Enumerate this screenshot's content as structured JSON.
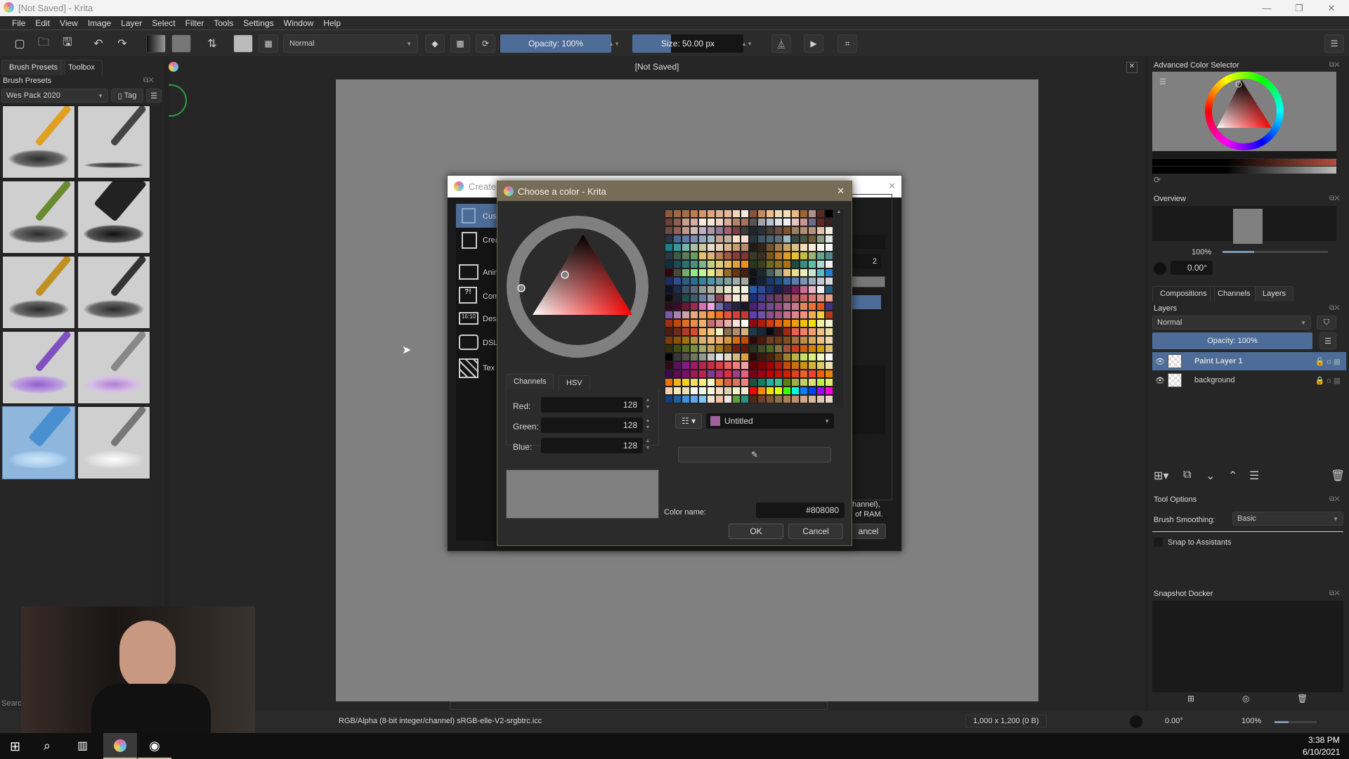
{
  "window": {
    "title": "[Not Saved]  - Krita",
    "minimize": "—",
    "maximize": "❐",
    "close": "✕"
  },
  "menu": [
    "File",
    "Edit",
    "View",
    "Image",
    "Layer",
    "Select",
    "Filter",
    "Tools",
    "Settings",
    "Window",
    "Help"
  ],
  "toolbar": {
    "blend_mode": "Normal",
    "opacity_label": "Opacity: 100%",
    "opacity_value": 1.0,
    "size_label": "Size: 50.00 px",
    "size_fill_fraction": 0.35,
    "icons": [
      "new-document",
      "open-document",
      "save",
      "undo",
      "redo",
      "gradient",
      "pattern",
      "swap-colors",
      "brush-preset",
      "workspace-chooser",
      "eraser",
      "preserve-alpha",
      "reload-preset",
      "mirror-horizontal",
      "mirror-vertical",
      "wrap-around"
    ]
  },
  "left_dock": {
    "tabs": [
      "Brush Presets",
      "Toolbox"
    ],
    "active_tab": 0,
    "title": "Brush Presets",
    "bundle": "Wes Pack 2020",
    "tag_label": "Tag",
    "search_placeholder": "Search",
    "brush_count": 10,
    "selected_brush": 8
  },
  "document": {
    "tab_title": "[Not Saved]",
    "canvas_color": "#808080"
  },
  "create_dialog": {
    "title": "Create new document",
    "title_visible": "Create n",
    "items": [
      "Custom Document",
      "Create from Clipboard",
      "Animation",
      "Comic Templates",
      "Design Templates",
      "DSLR Templates",
      "Texture Templates"
    ],
    "items_visible": [
      "Cus",
      "Crea",
      "Anin",
      "Com",
      "Des",
      "DSL",
      "Tex"
    ],
    "spin_value": "2",
    "info_text_1": "hannel),",
    "info_text_2": "of RAM.",
    "cancel_visible": "ancel",
    "close": "✕"
  },
  "color_dialog": {
    "title": "Choose a color - Krita",
    "close": "✕",
    "tabs": [
      "Channels",
      "HSV"
    ],
    "active_tab": 0,
    "channels": [
      {
        "label": "Red:",
        "value": "128"
      },
      {
        "label": "Green:",
        "value": "128"
      },
      {
        "label": "Blue:",
        "value": "128"
      }
    ],
    "preview_color": "#808080",
    "palette_name": "Untitled",
    "palette_swatch": "#a0609a",
    "color_name_label": "Color name:",
    "color_name_value": "#808080",
    "ok": "OK",
    "cancel": "Cancel",
    "palette_colors": [
      "#8d5a3c",
      "#a06a44",
      "#a86c48",
      "#c07c52",
      "#d8946a",
      "#dea47a",
      "#e0ae90",
      "#e4b898",
      "#f0d4c0",
      "#fae6dc",
      "#8a5238",
      "#c48a5c",
      "#ecbc8a",
      "#f0d8b8",
      "#f4dcb8",
      "#e8b880",
      "#9c6434",
      "#b0908a",
      "#5a2a20",
      "#000000",
      "#6a4030",
      "#886050",
      "#c4a090",
      "#d4aca4",
      "#f8eee0",
      "#f4e6d8",
      "#f0d4c0",
      "#d4b098",
      "#b48468",
      "#a87060",
      "#5a5454",
      "#a4a4ac",
      "#b8c0d0",
      "#dce0e8",
      "#f0f0f4",
      "#e4c4c4",
      "#c89494",
      "#6c6c8c",
      "#602828",
      "#3c2020",
      "#6a4a44",
      "#946058",
      "#c09890",
      "#d0bcb8",
      "#c0b0c0",
      "#a898a8",
      "#8e7898",
      "#a06070",
      "#784048",
      "#3c3c40",
      "#20262c",
      "#2c3038",
      "#484038",
      "#6c5040",
      "#7c5434",
      "#9c8064",
      "#b08c70",
      "#b49480",
      "#e4c4a8",
      "#f4ece0",
      "#283448",
      "#4a6894",
      "#5c7aa4",
      "#7c8cb0",
      "#94a8c0",
      "#a4b8c0",
      "#c4a490",
      "#c0b0a0",
      "#f4e0c8",
      "#f8dcd0",
      "#28343c",
      "#3c5868",
      "#4c6470",
      "#606c78",
      "#a0b8c4",
      "#384844",
      "#485440",
      "#6c5c3c",
      "#8c9c7c",
      "#e0e4e0",
      "#1e7c8c",
      "#3898a0",
      "#70b4b0",
      "#a8c0a4",
      "#d0c8a0",
      "#e8dcc8",
      "#e8d0b0",
      "#dcb48c",
      "#c89c6c",
      "#b88c6c",
      "#201c14",
      "#302418",
      "#74542c",
      "#a48048",
      "#c8a468",
      "#dcc08c",
      "#f4dcb0",
      "#f4ecd0",
      "#f8f8f0",
      "#f8f8f8",
      "#2c3448",
      "#3c5c48",
      "#5c7c58",
      "#6c9c60",
      "#e4c070",
      "#e0b07c",
      "#c07c60",
      "#9c5848",
      "#883c3c",
      "#783838",
      "#383c28",
      "#3c3020",
      "#7c5420",
      "#b47c28",
      "#d8a020",
      "#e8c030",
      "#c4bc44",
      "#a0b070",
      "#68a48c",
      "#4c8c8c",
      "#103040",
      "#1c4c5c",
      "#2c7070",
      "#4c9080",
      "#80b488",
      "#c0d080",
      "#e0cc74",
      "#e8b860",
      "#e89c34",
      "#f08c20",
      "#283820",
      "#3c4014",
      "#6c6820",
      "#8c7018",
      "#b07010",
      "#1c4c3c",
      "#3c8c7c",
      "#5cc0a8",
      "#a8dcd0",
      "#f0f0f0",
      "#300808",
      "#4c4438",
      "#7ca86c",
      "#94e490",
      "#c4f0a0",
      "#e8e890",
      "#e4c474",
      "#946c28",
      "#6c3410",
      "#4c2010",
      "#101418",
      "#1c2830",
      "#4c6060",
      "#849480",
      "#e4c080",
      "#e8dc90",
      "#ecf0b8",
      "#c8e8d0",
      "#5cbcc4",
      "#2080d0",
      "#1c2c68",
      "#2c4c9c",
      "#305c8c",
      "#2c6c8c",
      "#3c80a0",
      "#5098a8",
      "#6c9ca0",
      "#80a0a0",
      "#a0b0a8",
      "#a8aca0",
      "#0c1020",
      "#10203c",
      "#1c386c",
      "#184c7c",
      "#3868a8",
      "#5c7cb0",
      "#7c94b8",
      "#9cb0c4",
      "#c0c8d4",
      "#d8d8e0",
      "#101028",
      "#1c2c4c",
      "#3c5470",
      "#5c6c7c",
      "#909c98",
      "#b4b4a4",
      "#d0d0b0",
      "#e8e8c8",
      "#f0ecd4",
      "#f4f4e4",
      "#2060b0",
      "#2c4c90",
      "#1c3070",
      "#1c1c4c",
      "#401c48",
      "#802060",
      "#c86c90",
      "#e8b4c4",
      "#f0f0f4",
      "#206080",
      "#0c0c10",
      "#1c2030",
      "#1c4c4c",
      "#3c5c70",
      "#6c7c9c",
      "#9c9cb0",
      "#8c4050",
      "#e8b0b0",
      "#f4ecd8",
      "#f4e0c8",
      "#183080",
      "#3c3c8c",
      "#5c3c70",
      "#703c60",
      "#8c4c60",
      "#a8545c",
      "#c86460",
      "#d47c74",
      "#e4948c",
      "#ec9c88",
      "#2c0c18",
      "#3c0c28",
      "#6c1838",
      "#a02858",
      "#d870b0",
      "#e8a8e0",
      "#7070a8",
      "#3c3470",
      "#242440",
      "#181828",
      "#502070",
      "#603890",
      "#6c4c8c",
      "#8c4c80",
      "#a86c8c",
      "#c87888",
      "#e88460",
      "#f07034",
      "#e05818",
      "#3c3480",
      "#7c58a8",
      "#a880b4",
      "#d0a0a8",
      "#e8a880",
      "#f0a060",
      "#f09440",
      "#f07030",
      "#e85040",
      "#d04040",
      "#c03838",
      "#5c40b0",
      "#7050a8",
      "#8c5090",
      "#a05880",
      "#c07088",
      "#e0848c",
      "#f09080",
      "#f0b050",
      "#f0d040",
      "#b03818",
      "#a03010",
      "#c04810",
      "#d87028",
      "#e89048",
      "#f0b070",
      "#c07070",
      "#d89090",
      "#e8b0a8",
      "#f8e0dc",
      "#fcfcfc",
      "#900c0c",
      "#b01c0c",
      "#d03c0c",
      "#e85c0c",
      "#e87c0c",
      "#e8a00c",
      "#f0c00c",
      "#f0e00c",
      "#f0f0a0",
      "#f4f4d0",
      "#4c1c14",
      "#702818",
      "#b03c24",
      "#d84c2c",
      "#f0b060",
      "#f0c880",
      "#f4f0c0",
      "#8c7058",
      "#b08c6c",
      "#d4b07c",
      "#1c3c4c",
      "#182838",
      "#080810",
      "#3c1818",
      "#a02818",
      "#f06050",
      "#f08060",
      "#f0a070",
      "#f0c080",
      "#f0e0a0",
      "#803c08",
      "#905008",
      "#a07010",
      "#b89040",
      "#d8b070",
      "#e8b880",
      "#e8b070",
      "#d89840",
      "#d86c10",
      "#c04c08",
      "#300808",
      "#501808",
      "#704020",
      "#704018",
      "#7c5020",
      "#a87040",
      "#c08c48",
      "#d0a860",
      "#e8c480",
      "#ecd8b0",
      "#303008",
      "#404c10",
      "#586c20",
      "#7c9040",
      "#a4a860",
      "#c0a060",
      "#b07c18",
      "#805010",
      "#702008",
      "#5c1808",
      "#283020",
      "#404c28",
      "#506820",
      "#807048",
      "#a05038",
      "#c84020",
      "#d06010",
      "#d08010",
      "#d0a010",
      "#e0c070",
      "#000000",
      "#383838",
      "#505048",
      "#707860",
      "#909890",
      "#c4c4c0",
      "#e8e8e8",
      "#e0d8c0",
      "#d4b880",
      "#e0a040",
      "#280808",
      "#3c1808",
      "#502008",
      "#6c4010",
      "#a08030",
      "#b8b840",
      "#c8e060",
      "#e0f080",
      "#f0f8c0",
      "#f8f8f8",
      "#300818",
      "#581458",
      "#881888",
      "#a01868",
      "#b02848",
      "#c03040",
      "#d84040",
      "#e86060",
      "#f08080",
      "#f0a0a0",
      "#600000",
      "#800000",
      "#a00000",
      "#b01810",
      "#c04c10",
      "#c87010",
      "#d09010",
      "#d8b040",
      "#e0c870",
      "#f0e0b0",
      "#380c48",
      "#600c50",
      "#800c70",
      "#a01858",
      "#c02050",
      "#7c3c8c",
      "#b02c78",
      "#e02c40",
      "#a03c80",
      "#e86080",
      "#780010",
      "#a00010",
      "#c00000",
      "#c01010",
      "#d02000",
      "#e04020",
      "#f06020",
      "#f04030",
      "#f06000",
      "#f08000",
      "#f07000",
      "#f0b020",
      "#f0d020",
      "#f0e060",
      "#f0f080",
      "#f8f8c0",
      "#f09030",
      "#e06040",
      "#e07060",
      "#f08080",
      "#205040",
      "#108060",
      "#20b0a0",
      "#40c090",
      "#608010",
      "#a0b040",
      "#c0d060",
      "#e0e070",
      "#c0f040",
      "#e0f060",
      "#f8d0b0",
      "#f0e8b0",
      "#e8e0b0",
      "#f8f8f0",
      "#f0f8e8",
      "#f8f8e0",
      "#f8e0c0",
      "#e0d0b0",
      "#f0f0d0",
      "#f8e8d0",
      "#ff0000",
      "#ff8800",
      "#f0e000",
      "#e0ff00",
      "#40ff00",
      "#00ffe0",
      "#0080ff",
      "#0040ff",
      "#a000ff",
      "#ff00e0",
      "#104080",
      "#2060a0",
      "#3c90e0",
      "#60a8e8",
      "#80c8f0",
      "#f0e0d0",
      "#f0c0a0",
      "#f0e0e0",
      "#60a040",
      "#309080",
      "#502818",
      "#704028",
      "#805838",
      "#907048",
      "#a88058",
      "#c09070",
      "#d0a888",
      "#d8b8a0",
      "#e0c8b8",
      "#e8d8c8"
    ]
  },
  "right_dock": {
    "adv_color_title": "Advanced Color Selector",
    "overview_title": "Overview",
    "overview_zoom": "100%",
    "overview_zoom_fraction": 0.3,
    "overview_rotation": "0.00°",
    "tabs": [
      "Compositions",
      "Channels",
      "Layers"
    ],
    "active_tab": 2,
    "layers_title": "Layers",
    "blend_mode": "Normal",
    "opacity_label": "Opacity:  100%",
    "layers": [
      {
        "name": "Paint Layer 1",
        "visible": true,
        "selected": true
      },
      {
        "name": "background",
        "visible": true,
        "selected": false
      }
    ],
    "tool_options_title": "Tool Options",
    "brush_smoothing_label": "Brush Smoothing:",
    "brush_smoothing_value": "Basic",
    "snap_label": "Snap to Assistants",
    "snap_checked": false,
    "snapshot_title": "Snapshot Docker"
  },
  "status": {
    "color_profile": "RGB/Alpha (8-bit integer/channel)  sRGB-elle-V2-srgbtrc.icc",
    "dimensions": "1,000 x 1,200 (0 B)",
    "rotation": "0.00°",
    "zoom": "100%"
  },
  "taskbar": {
    "time": "3:38 PM",
    "date": "6/10/2021"
  }
}
